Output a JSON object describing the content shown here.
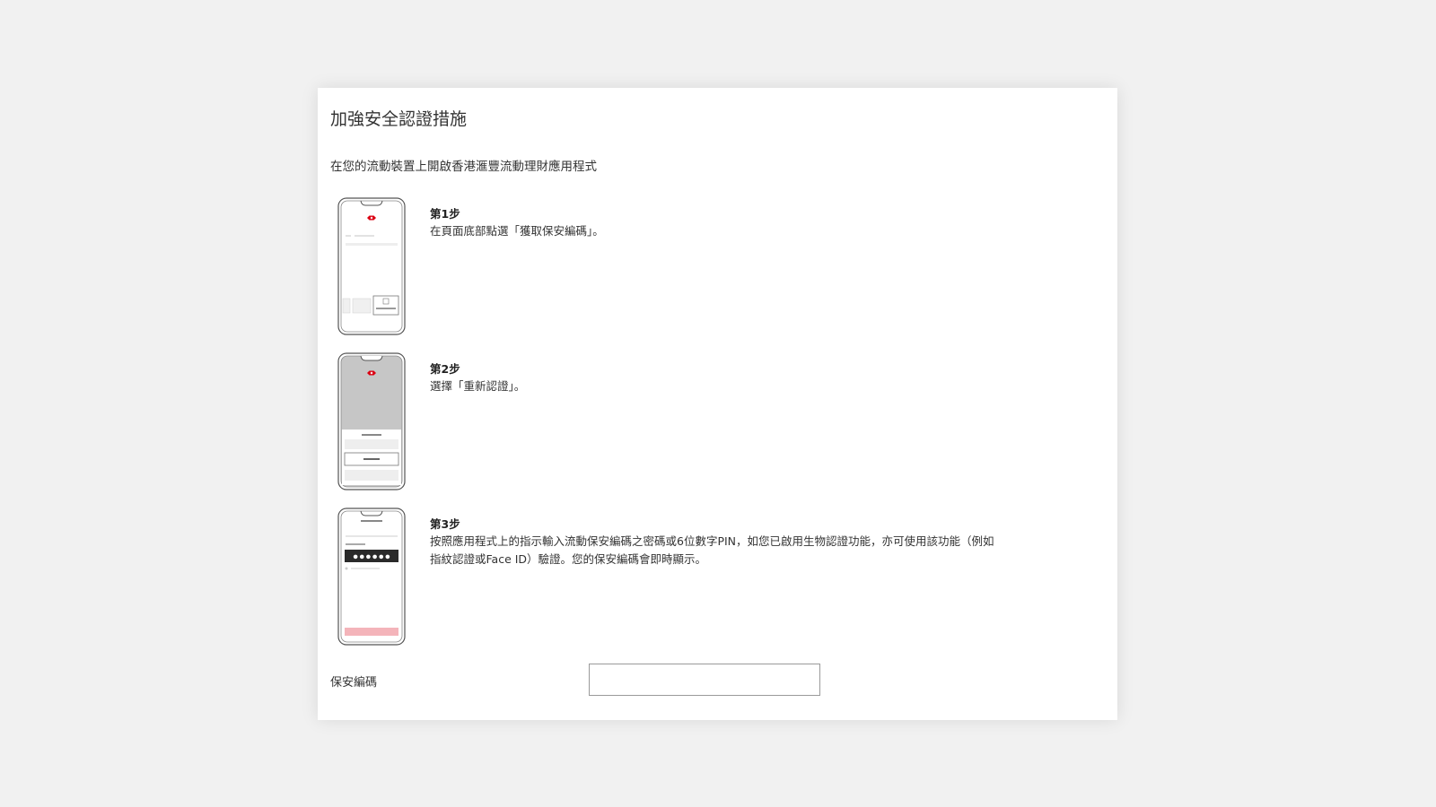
{
  "page": {
    "title": "加強安全認證措施",
    "subtitle": "在您的流動裝置上開啟香港滙豐流動理財應用程式"
  },
  "steps": [
    {
      "label": "第1步",
      "description": "在頁面底部點選「獲取保安編碼」。",
      "phone_icon": "phone-step1-home-screen-icon"
    },
    {
      "label": "第2步",
      "description": "選擇「重新認證」。",
      "phone_icon": "phone-step2-reauth-menu-icon"
    },
    {
      "label": "第3步",
      "description": "按照應用程式上的指示輸入流動保安編碼之密碼或6位數字PIN，如您已啟用生物認證功能，亦可使用該功能（例如指紋認證或Face ID）驗證。您的保安編碼會即時顯示。",
      "phone_icon": "phone-step3-pin-entry-icon"
    }
  ],
  "security_code": {
    "label": "保安編碼",
    "value": "",
    "placeholder": ""
  },
  "colors": {
    "background": "#f1f1f1",
    "card": "#ffffff",
    "brand_red": "#db0011",
    "text": "#333333",
    "input_border": "#9a9a9a"
  }
}
